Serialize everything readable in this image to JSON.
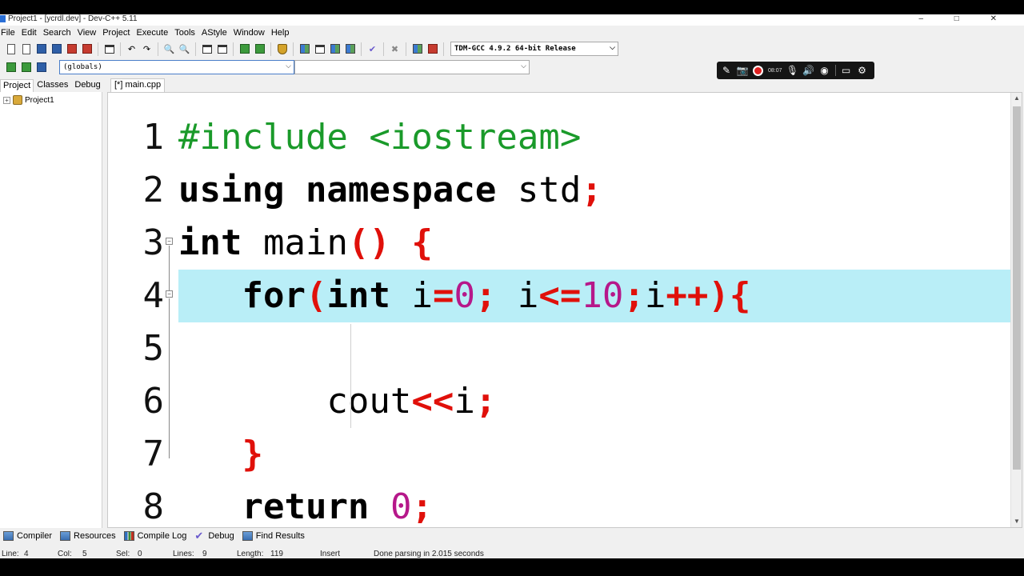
{
  "window": {
    "title": "Project1 - [ycrdl.dev] - Dev-C++ 5.11",
    "controls": "–  □  ✕"
  },
  "menu": [
    "File",
    "Edit",
    "Search",
    "View",
    "Project",
    "Execute",
    "Tools",
    "AStyle",
    "Window",
    "Help"
  ],
  "toolbar": {
    "compiler": "TDM-GCC 4.9.2 64-bit Release"
  },
  "scope_bar": {
    "globals": "(globals)",
    "members": ""
  },
  "recorder": {
    "time": "08:07"
  },
  "left_tabs": [
    "Project",
    "Classes",
    "Debug"
  ],
  "project_tree": {
    "expander": "+",
    "root": "Project1"
  },
  "editor": {
    "tab": "[*] main.cpp",
    "line_numbers": [
      "1",
      "2",
      "3",
      "4",
      "5",
      "6",
      "7",
      "8"
    ],
    "current_line": 4
  },
  "bottom_tabs": [
    "Compiler",
    "Resources",
    "Compile Log",
    "Debug",
    "Find Results"
  ],
  "status": {
    "line": "Line:",
    "line_val": "4",
    "col": "Col:",
    "col_val": "5",
    "sel": "Sel:",
    "sel_val": "0",
    "lines": "Lines:",
    "lines_val": "9",
    "length": "Length:",
    "length_val": "119",
    "mode": "Insert",
    "message": "Done parsing in 2.015 seconds"
  },
  "colors": {
    "current_line": "#b9eef7",
    "preprocessor": "#1a9a2a",
    "symbol": "#e0100a",
    "number": "#b6188a"
  }
}
